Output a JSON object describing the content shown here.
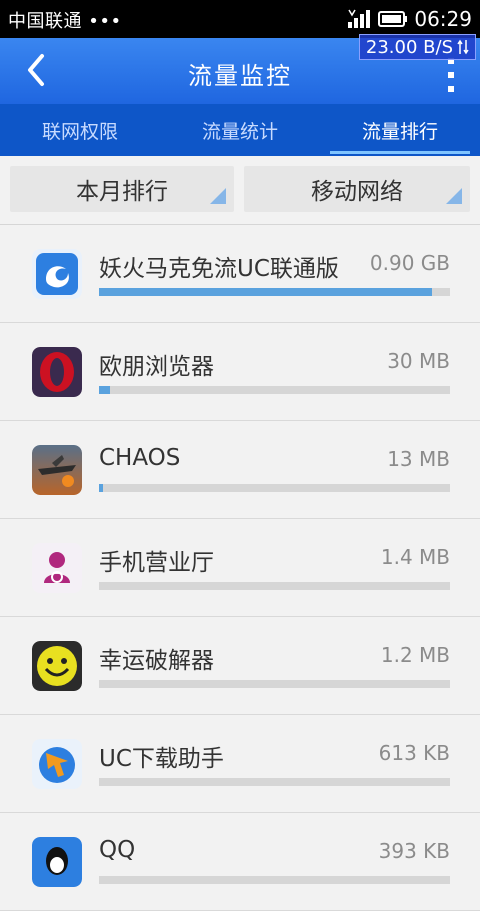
{
  "status": {
    "carrier": "中国联通 •••",
    "time": "06:29",
    "speed": "23.00 B/S"
  },
  "header": {
    "title": "流量监控"
  },
  "tabs": [
    {
      "label": "联网权限",
      "active": false
    },
    {
      "label": "流量统计",
      "active": false
    },
    {
      "label": "流量排行",
      "active": true
    }
  ],
  "filters": {
    "period": "本月排行",
    "network": "移动网络"
  },
  "apps": [
    {
      "name": "妖火马克免流UC联通版",
      "size": "0.90 GB",
      "usage_fraction": 0.95,
      "icon": "uc-browser-icon"
    },
    {
      "name": "欧朋浏览器",
      "size": "30 MB",
      "usage_fraction": 0.03,
      "icon": "opera-icon"
    },
    {
      "name": "CHAOS",
      "size": "13 MB",
      "usage_fraction": 0.012,
      "icon": "chaos-game-icon"
    },
    {
      "name": "手机营业厅",
      "size": "1.4 MB",
      "usage_fraction": 0.0,
      "icon": "unicom-service-icon"
    },
    {
      "name": "幸运破解器",
      "size": "1.2 MB",
      "usage_fraction": 0.0,
      "icon": "lucky-patcher-icon"
    },
    {
      "name": "UC下载助手",
      "size": "613 KB",
      "usage_fraction": 0.0,
      "icon": "uc-download-icon"
    },
    {
      "name": "QQ",
      "size": "393 KB",
      "usage_fraction": 0.0,
      "icon": "qq-icon"
    }
  ],
  "colors": {
    "header": "#1f66e0",
    "tabs": "#0e56c8",
    "bar_fill": "#5aa2de",
    "bar_track": "#d6d6d6"
  }
}
